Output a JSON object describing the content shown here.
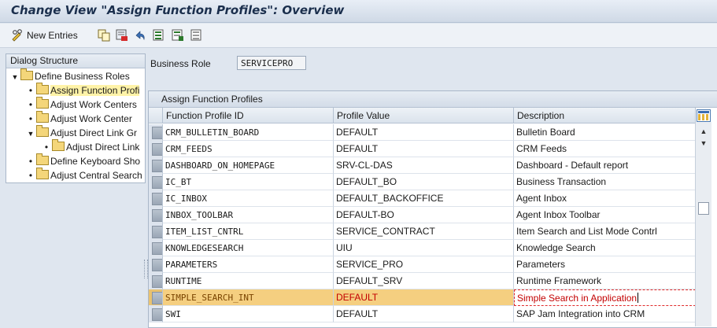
{
  "window": {
    "title": "Change View \"Assign Function Profiles\": Overview"
  },
  "toolbar": {
    "new_entries_label": "New Entries",
    "icons": [
      "pencil-glasses-icon",
      "copy-icon",
      "delete-icon",
      "undo-icon",
      "select-all-icon",
      "select-block-icon",
      "deselect-all-icon"
    ]
  },
  "dialog_structure": {
    "title": "Dialog Structure",
    "items": [
      {
        "label": "Define Business Roles",
        "level": 0,
        "expanded": true
      },
      {
        "label": "Assign Function Profi",
        "level": 1,
        "selected": true
      },
      {
        "label": "Adjust Work Centers",
        "level": 1
      },
      {
        "label": "Adjust Work Center",
        "level": 1
      },
      {
        "label": "Adjust Direct Link Gr",
        "level": 1,
        "expanded": true
      },
      {
        "label": "Adjust Direct Link",
        "level": 2
      },
      {
        "label": "Define Keyboard Sho",
        "level": 1
      },
      {
        "label": "Adjust Central Search",
        "level": 1
      }
    ]
  },
  "business_role": {
    "label": "Business Role",
    "value": "SERVICEPRO"
  },
  "table": {
    "caption": "Assign Function Profiles",
    "columns": [
      "Function Profile ID",
      "Profile Value",
      "Description"
    ],
    "rows": [
      {
        "id": "CRM_BULLETIN_BOARD",
        "value": "DEFAULT",
        "description": "Bulletin Board"
      },
      {
        "id": "CRM_FEEDS",
        "value": "DEFAULT",
        "description": "CRM Feeds"
      },
      {
        "id": "DASHBOARD_ON_HOMEPAGE",
        "value": "SRV-CL-DAS",
        "description": "Dashboard - Default report"
      },
      {
        "id": "IC_BT",
        "value": "DEFAULT_BO",
        "description": "Business Transaction"
      },
      {
        "id": "IC_INBOX",
        "value": "DEFAULT_BACKOFFICE",
        "description": "Agent Inbox"
      },
      {
        "id": "INBOX_TOOLBAR",
        "value": "DEFAULT-BO",
        "description": "Agent Inbox Toolbar"
      },
      {
        "id": "ITEM_LIST_CNTRL",
        "value": "SERVICE_CONTRACT",
        "description": "Item Search and List Mode Contrl"
      },
      {
        "id": "KNOWLEDGESEARCH",
        "value": "UIU",
        "description": "Knowledge Search"
      },
      {
        "id": "PARAMETERS",
        "value": "SERVICE_PRO",
        "description": "Parameters"
      },
      {
        "id": "RUNTIME",
        "value": "DEFAULT_SRV",
        "description": "Runtime Framework"
      },
      {
        "id": "SIMPLE_SEARCH_INT",
        "value": "DEFAULT",
        "description": "Simple Search in Application",
        "active": true
      },
      {
        "id": "SWI",
        "value": "DEFAULT",
        "description": "SAP Jam Integration into CRM"
      }
    ]
  },
  "colors": {
    "accent": "#f5cf80",
    "error_text": "#c30000",
    "header_bg": "#d3dce8"
  }
}
